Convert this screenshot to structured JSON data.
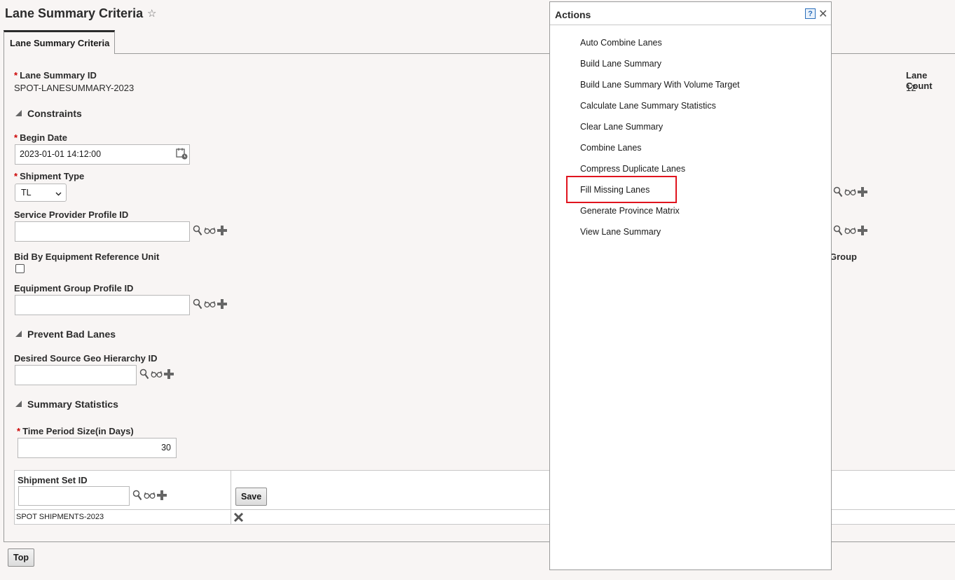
{
  "page": {
    "title": "Lane Summary Criteria",
    "tab_label": "Lane Summary Criteria"
  },
  "fields": {
    "lane_summary_id_label": "Lane Summary ID",
    "lane_summary_id_value": "SPOT-LANESUMMARY-2023",
    "lane_count_label": "Lane Count",
    "lane_count_value": "12",
    "constraints_header": "Constraints",
    "begin_date_label": "Begin Date",
    "begin_date_value": "2023-01-01 14:12:00",
    "shipment_type_label": "Shipment Type",
    "shipment_type_value": "TL",
    "service_provider_label": "Service Provider Profile ID",
    "service_provider_value": "",
    "bid_by_equipment_label": "Bid By Equipment Reference Unit",
    "equipment_group_label": "Equipment Group Profile ID",
    "equipment_group_value": "",
    "partial_group_label": "Group",
    "prevent_bad_lanes_header": "Prevent Bad Lanes",
    "desired_source_label": "Desired Source Geo Hierarchy ID",
    "desired_source_value": "",
    "summary_statistics_header": "Summary Statistics",
    "time_period_label": "Time Period Size(in Days)",
    "time_period_value": "30"
  },
  "shipment_table": {
    "header": "Shipment Set ID",
    "input_value": "",
    "save_label": "Save",
    "rows": [
      {
        "id": "SPOT SHIPMENTS-2023"
      }
    ]
  },
  "footer": {
    "top_button": "Top"
  },
  "actions_popup": {
    "title": "Actions",
    "help_glyph": "?",
    "close_glyph": "✕",
    "highlighted_item": "Fill Missing Lanes",
    "items": [
      "Auto Combine Lanes",
      "Build Lane Summary",
      "Build Lane Summary With Volume Target",
      "Calculate Lane Summary Statistics",
      "Clear Lane Summary",
      "Combine Lanes",
      "Compress Duplicate Lanes",
      "Fill Missing Lanes",
      "Generate Province Matrix",
      "View Lane Summary"
    ]
  },
  "icons": {
    "star": "star-icon",
    "calendar": "calendar-icon",
    "search": "search-icon",
    "view": "glasses-icon",
    "add": "plus-icon",
    "delete": "x-delete-icon",
    "required_marker": "*"
  },
  "colors": {
    "background": "#f8f5f4",
    "required": "#cc0000",
    "highlight_box": "#e0141e",
    "help_blue": "#2a6ebb"
  }
}
